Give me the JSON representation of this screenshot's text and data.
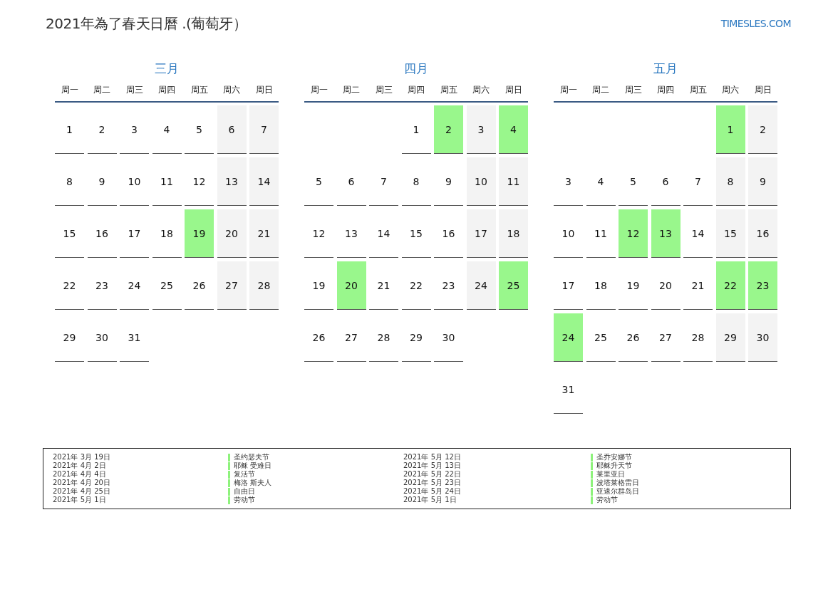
{
  "title": "2021年為了春天日曆 .(葡萄牙）",
  "logo": "TIMESLES.COM",
  "months": [
    {
      "name": "三月",
      "weekdays": [
        "周一",
        "周二",
        "周三",
        "周四",
        "周五",
        "周六",
        "周日"
      ],
      "weeks": [
        [
          {
            "day": "1",
            "kind": "weekday"
          },
          {
            "day": "2",
            "kind": "weekday"
          },
          {
            "day": "3",
            "kind": "weekday"
          },
          {
            "day": "4",
            "kind": "weekday"
          },
          {
            "day": "5",
            "kind": "weekday"
          },
          {
            "day": "6",
            "kind": "weekend"
          },
          {
            "day": "7",
            "kind": "weekend"
          }
        ],
        [
          {
            "day": "8",
            "kind": "weekday"
          },
          {
            "day": "9",
            "kind": "weekday"
          },
          {
            "day": "10",
            "kind": "weekday"
          },
          {
            "day": "11",
            "kind": "weekday"
          },
          {
            "day": "12",
            "kind": "weekday"
          },
          {
            "day": "13",
            "kind": "weekend"
          },
          {
            "day": "14",
            "kind": "weekend"
          }
        ],
        [
          {
            "day": "15",
            "kind": "weekday"
          },
          {
            "day": "16",
            "kind": "weekday"
          },
          {
            "day": "17",
            "kind": "weekday"
          },
          {
            "day": "18",
            "kind": "weekday"
          },
          {
            "day": "19",
            "kind": "holiday"
          },
          {
            "day": "20",
            "kind": "weekend"
          },
          {
            "day": "21",
            "kind": "weekend"
          }
        ],
        [
          {
            "day": "22",
            "kind": "weekday"
          },
          {
            "day": "23",
            "kind": "weekday"
          },
          {
            "day": "24",
            "kind": "weekday"
          },
          {
            "day": "25",
            "kind": "weekday"
          },
          {
            "day": "26",
            "kind": "weekday"
          },
          {
            "day": "27",
            "kind": "weekend"
          },
          {
            "day": "28",
            "kind": "weekend"
          }
        ],
        [
          {
            "day": "29",
            "kind": "weekday"
          },
          {
            "day": "30",
            "kind": "weekday"
          },
          {
            "day": "31",
            "kind": "weekday"
          }
        ]
      ]
    },
    {
      "name": "四月",
      "weekdays": [
        "周一",
        "周二",
        "周三",
        "周四",
        "周五",
        "周六",
        "周日"
      ],
      "weeks": [
        [
          {
            "kind": "blank"
          },
          {
            "kind": "blank"
          },
          {
            "kind": "blank"
          },
          {
            "day": "1",
            "kind": "weekday"
          },
          {
            "day": "2",
            "kind": "holiday"
          },
          {
            "day": "3",
            "kind": "weekend"
          },
          {
            "day": "4",
            "kind": "holiday"
          }
        ],
        [
          {
            "day": "5",
            "kind": "weekday"
          },
          {
            "day": "6",
            "kind": "weekday"
          },
          {
            "day": "7",
            "kind": "weekday"
          },
          {
            "day": "8",
            "kind": "weekday"
          },
          {
            "day": "9",
            "kind": "weekday"
          },
          {
            "day": "10",
            "kind": "weekend"
          },
          {
            "day": "11",
            "kind": "weekend"
          }
        ],
        [
          {
            "day": "12",
            "kind": "weekday"
          },
          {
            "day": "13",
            "kind": "weekday"
          },
          {
            "day": "14",
            "kind": "weekday"
          },
          {
            "day": "15",
            "kind": "weekday"
          },
          {
            "day": "16",
            "kind": "weekday"
          },
          {
            "day": "17",
            "kind": "weekend"
          },
          {
            "day": "18",
            "kind": "weekend"
          }
        ],
        [
          {
            "day": "19",
            "kind": "weekday"
          },
          {
            "day": "20",
            "kind": "holiday"
          },
          {
            "day": "21",
            "kind": "weekday"
          },
          {
            "day": "22",
            "kind": "weekday"
          },
          {
            "day": "23",
            "kind": "weekday"
          },
          {
            "day": "24",
            "kind": "weekend"
          },
          {
            "day": "25",
            "kind": "holiday"
          }
        ],
        [
          {
            "day": "26",
            "kind": "weekday"
          },
          {
            "day": "27",
            "kind": "weekday"
          },
          {
            "day": "28",
            "kind": "weekday"
          },
          {
            "day": "29",
            "kind": "weekday"
          },
          {
            "day": "30",
            "kind": "weekday"
          }
        ]
      ]
    },
    {
      "name": "五月",
      "weekdays": [
        "周一",
        "周二",
        "周三",
        "周四",
        "周五",
        "周六",
        "周日"
      ],
      "weeks": [
        [
          {
            "kind": "blank"
          },
          {
            "kind": "blank"
          },
          {
            "kind": "blank"
          },
          {
            "kind": "blank"
          },
          {
            "kind": "blank"
          },
          {
            "day": "1",
            "kind": "holiday"
          },
          {
            "day": "2",
            "kind": "weekend"
          }
        ],
        [
          {
            "day": "3",
            "kind": "weekday"
          },
          {
            "day": "4",
            "kind": "weekday"
          },
          {
            "day": "5",
            "kind": "weekday"
          },
          {
            "day": "6",
            "kind": "weekday"
          },
          {
            "day": "7",
            "kind": "weekday"
          },
          {
            "day": "8",
            "kind": "weekend"
          },
          {
            "day": "9",
            "kind": "weekend"
          }
        ],
        [
          {
            "day": "10",
            "kind": "weekday"
          },
          {
            "day": "11",
            "kind": "weekday"
          },
          {
            "day": "12",
            "kind": "holiday"
          },
          {
            "day": "13",
            "kind": "holiday"
          },
          {
            "day": "14",
            "kind": "weekday"
          },
          {
            "day": "15",
            "kind": "weekend"
          },
          {
            "day": "16",
            "kind": "weekend"
          }
        ],
        [
          {
            "day": "17",
            "kind": "weekday"
          },
          {
            "day": "18",
            "kind": "weekday"
          },
          {
            "day": "19",
            "kind": "weekday"
          },
          {
            "day": "20",
            "kind": "weekday"
          },
          {
            "day": "21",
            "kind": "weekday"
          },
          {
            "day": "22",
            "kind": "holiday"
          },
          {
            "day": "23",
            "kind": "holiday"
          }
        ],
        [
          {
            "day": "24",
            "kind": "holiday"
          },
          {
            "day": "25",
            "kind": "weekday"
          },
          {
            "day": "26",
            "kind": "weekday"
          },
          {
            "day": "27",
            "kind": "weekday"
          },
          {
            "day": "28",
            "kind": "weekday"
          },
          {
            "day": "29",
            "kind": "weekend"
          },
          {
            "day": "30",
            "kind": "weekend"
          }
        ],
        [
          {
            "day": "31",
            "kind": "weekday"
          }
        ]
      ]
    }
  ],
  "holiday_list": [
    {
      "entries": [
        {
          "date": "2021年 3月 19日",
          "name": "圣约瑟夫节"
        },
        {
          "date": "2021年 4月 2日",
          "name": "耶稣 受难日"
        },
        {
          "date": "2021年 4月 4日",
          "name": "复活节"
        },
        {
          "date": "2021年 4月 20日",
          "name": "梅洛 斯夫人"
        },
        {
          "date": "2021年 4月 25日",
          "name": "自由日"
        },
        {
          "date": "2021年 5月 1日",
          "name": "劳动节"
        }
      ]
    },
    {
      "entries": [
        {
          "date": "2021年 5月 12日",
          "name": "圣乔安娜节"
        },
        {
          "date": "2021年 5月 13日",
          "name": "耶稣升天节"
        },
        {
          "date": "2021年 5月 22日",
          "name": "莱里亚日"
        },
        {
          "date": "2021年 5月 23日",
          "name": "波塔莱格雷日"
        },
        {
          "date": "2021年 5月 24日",
          "name": "亚速尔群岛日"
        },
        {
          "date": "2021年 5月 1日",
          "name": "劳动节"
        }
      ]
    }
  ]
}
